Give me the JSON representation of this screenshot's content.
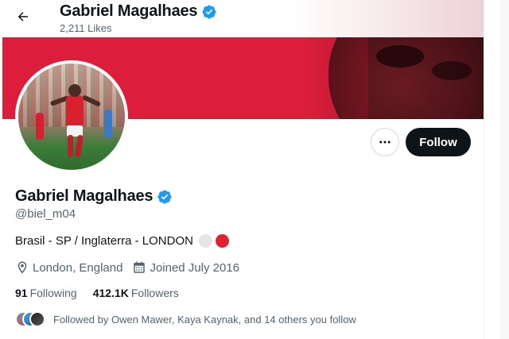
{
  "header": {
    "name": "Gabriel Magalhaes",
    "likes": "2,211 Likes"
  },
  "actions": {
    "more_label": "•••",
    "follow_label": "Follow"
  },
  "profile": {
    "name": "Gabriel Magalhaes",
    "handle": "@biel_m04",
    "bio": "Brasil - SP / Inglaterra - LONDON",
    "location": "London, England",
    "joined": "Joined July 2016",
    "following_count": "91",
    "following_label": "Following",
    "followers_count": "412.1K",
    "followers_label": "Followers",
    "followed_by": "Followed by Owen Mawer, Kaya Kaynak, and 14 others you follow"
  },
  "icons": {
    "back": "arrow-left-icon",
    "verified": "verified-badge-icon",
    "location": "location-pin-icon",
    "calendar": "calendar-icon",
    "more": "more-dots-icon"
  },
  "colors": {
    "banner": "#dc1e3a",
    "verified": "#1d9bf0",
    "follow_button": "#0f1419",
    "muted_text": "#536471",
    "bio_dot_white": "#e6e6e6",
    "bio_dot_red": "#e0222f"
  }
}
